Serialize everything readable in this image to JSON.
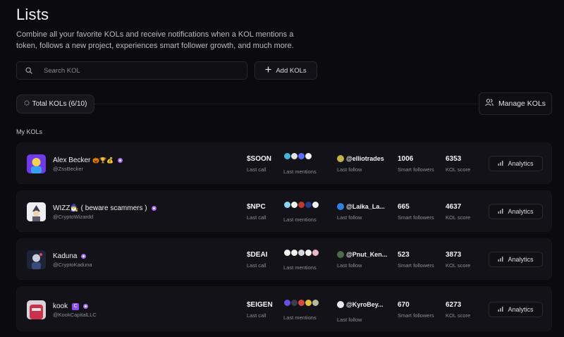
{
  "header": {
    "title": "Lists",
    "description": "Combine all your favorite KOLs and receive notifications when a KOL mentions a token, follows a new project, experiences smart follower growth, and much more."
  },
  "search": {
    "placeholder": "Search KOL",
    "value": ""
  },
  "add_button": {
    "label": "Add KOLs",
    "icon": "plus-icon"
  },
  "total_chip": {
    "label": "Total KOLs (6/10)",
    "icon": "loader-icon"
  },
  "manage_button": {
    "label": "Manage KOLs",
    "icon": "users-icon"
  },
  "section_label": "My KOLs",
  "column_labels": {
    "last_call": "Last call",
    "last_mentions": "Last mentions",
    "last_follow": "Last follow",
    "smart_followers": "Smart followers",
    "kol_score": "KOL score",
    "analytics": "Analytics"
  },
  "rows": [
    {
      "name": "Alex Becker",
      "name_emojis": "🎃🏆💰",
      "handle": "@ZssBecker",
      "avatar_color": "#7a3cf0",
      "last_call": "$SOON",
      "mention_colors": [
        "#3fb7d8",
        "#e0e0e6",
        "#5b6cff",
        "#f2f2f2"
      ],
      "follow_handle": "@elliotrades",
      "follow_avatar_color": "#c4b24a",
      "smart_followers": "1006",
      "kol_score": "6353"
    },
    {
      "name": "WIZZ🧙‍♂️ ( beware scammers )",
      "name_emojis": "",
      "handle": "@CryptoWizardd",
      "avatar_color": "#e8e8ee",
      "last_call": "$NPC",
      "mention_colors": [
        "#8fd3f2",
        "#f2f2f2",
        "#c0392b",
        "#223c8c",
        "#f2f2f2"
      ],
      "follow_handle": "@Laika_La...",
      "follow_avatar_color": "#2d7fe0",
      "smart_followers": "665",
      "kol_score": "4637"
    },
    {
      "name": "Kaduna",
      "name_emojis": "",
      "handle": "@CryptoKaduna",
      "avatar_color": "#2b3550",
      "last_call": "$DEAI",
      "mention_colors": [
        "#f2f2f2",
        "#f2f2f2",
        "#d8d8de",
        "#f2f2f2",
        "#e7b8c8"
      ],
      "follow_handle": "@Pnut_Ken...",
      "follow_avatar_color": "#4a6a4a",
      "smart_followers": "523",
      "kol_score": "3873"
    },
    {
      "name": "kook",
      "name_emojis": "",
      "handle": "@KookCapitalLLC",
      "avatar_color": "#c8324a",
      "last_call": "$EIGEN",
      "mention_colors": [
        "#6b4de6",
        "#3c3c50",
        "#d64a3a",
        "#e4c040",
        "#b8b89a"
      ],
      "follow_handle": "@KyroBey...",
      "follow_avatar_color": "#e8e8ee",
      "smart_followers": "670",
      "kol_score": "6273"
    }
  ]
}
